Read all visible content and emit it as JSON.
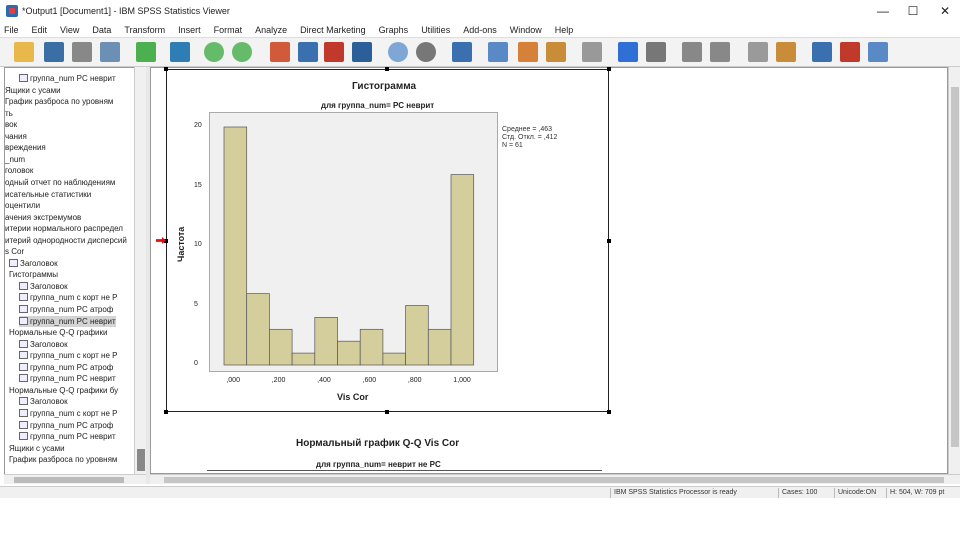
{
  "window": {
    "title": "*Output1 [Document1] - IBM SPSS Statistics Viewer"
  },
  "menu": [
    "File",
    "Edit",
    "View",
    "Data",
    "Transform",
    "Insert",
    "Format",
    "Analyze",
    "Direct Marketing",
    "Graphs",
    "Utilities",
    "Add-ons",
    "Window",
    "Help"
  ],
  "outline": [
    "группа_num  PC неврит",
    "Ящики с усами",
    "График разброса по уровням",
    "ть",
    "вок",
    "чания",
    "вреждения",
    "_num",
    "головок",
    "одный отчет по наблюдениям",
    "исательные статистики",
    "оцентили",
    "ачения экстремумов",
    "итерии нормального распредел",
    "итерий однородности дисперсий",
    "s Cor",
    "Заголовок",
    "Гистограммы",
    "Заголовок",
    "группа_num  с корт не Р",
    "группа_num  PC атроф",
    "группа_num  PC неврит",
    "Нормальные Q-Q графики",
    "Заголовок",
    "группа_num  с корт не Р",
    "группа_num  PC атроф",
    "группа_num  PC неврит",
    "Нормальные Q-Q графики бу",
    "Заголовок",
    "группа_num  с корт не Р",
    "группа_num  PC атроф",
    "группа_num  PC неврит",
    "Ящики с усами",
    "График разброса по уровням"
  ],
  "histogram": {
    "title": "Гистограмма",
    "subtitle": "для группа_num= PC неврит",
    "xlabel": "Vis Cor",
    "ylabel": "Частота",
    "bars": [
      20,
      6,
      3,
      1,
      4,
      2,
      3,
      1,
      5,
      3,
      16
    ],
    "bin_width": 0.1,
    "bin_start": -0.05,
    "ylim": [
      0,
      20
    ],
    "yticks": [
      "20",
      "15",
      "10",
      "5",
      "0"
    ],
    "xticks": [
      ",000",
      ",200",
      ",400",
      ",600",
      ",800",
      "1,000"
    ],
    "bar_color": "#d4cd9c",
    "stats": [
      "Среднее = ,463",
      "Стд. Откл. = ,412",
      "N = 61"
    ]
  },
  "qq": {
    "title": "Нормальный график Q-Q Vis Cor",
    "subtitle": "для группа_num= неврит не PC"
  },
  "status": [
    "IBM SPSS Statistics Processor is ready",
    "Cases: 100",
    "Unicode:ON",
    "H: 504, W: 709 pt"
  ]
}
